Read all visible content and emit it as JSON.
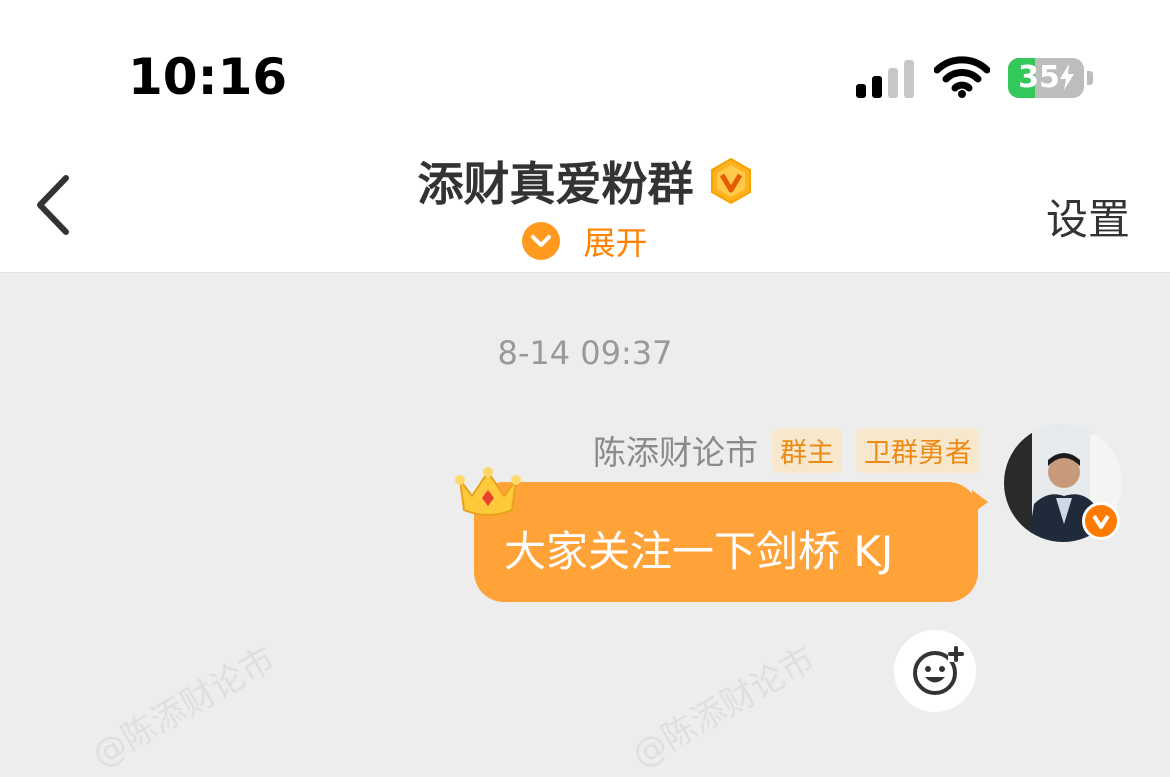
{
  "status": {
    "time": "10:16",
    "battery": "35",
    "battery_level": 0.35
  },
  "header": {
    "title": "添财真爱粉群",
    "expand_label": "展开",
    "settings_label": "设置"
  },
  "chat": {
    "timestamp": "8-14 09:37",
    "message": {
      "sender": "陈添财论市",
      "tags": [
        "群主",
        "卫群勇者"
      ],
      "text": "大家关注一下剑桥 KJ"
    }
  },
  "watermark": "@陈添财论市",
  "colors": {
    "accent": "#ff8200",
    "bubble": "#ffa238",
    "tag_bg": "#f7e7cd",
    "tag_text": "#ee8a14",
    "background": "#ededed"
  },
  "icons": [
    "back-chevron-icon",
    "vip-badge-icon",
    "chevron-down-icon",
    "crown-icon",
    "emoji-add-icon",
    "signal-icon",
    "wifi-icon",
    "battery-icon"
  ]
}
